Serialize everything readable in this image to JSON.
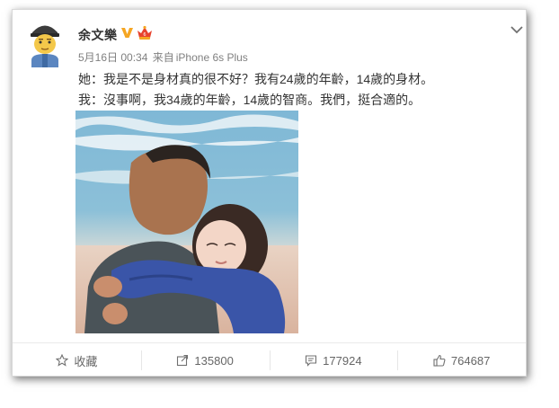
{
  "post": {
    "author": "余文樂",
    "date": "5月16日 00:34",
    "source_prefix": "来自",
    "source_device": "iPhone 6s Plus",
    "lines": [
      "她：我是不是身材真的很不好？我有24歲的年齡，14歲的身材。",
      "我：沒事啊，我34歲的年齡，14歲的智商。我們，挺合適的。"
    ]
  },
  "actions": {
    "favorite_label": "收藏",
    "repost_count": "135800",
    "comment_count": "177924",
    "like_count": "764687"
  },
  "icons": {
    "verified": "verified-v-icon",
    "vip": "vip-crown-icon",
    "menu": "chevron-down-icon",
    "favorite": "star-icon",
    "repost": "share-arrow-icon",
    "comment": "comment-bubble-icon",
    "like": "thumbs-up-icon"
  },
  "colors": {
    "verified": "#f5a623",
    "vip": "#e8432e",
    "text": "#333333",
    "meta": "#808080"
  }
}
